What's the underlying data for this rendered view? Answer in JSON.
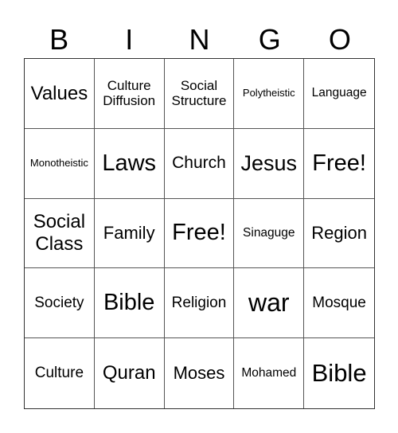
{
  "header": {
    "letters": [
      "B",
      "I",
      "N",
      "G",
      "O"
    ]
  },
  "grid": {
    "rows": [
      [
        "Values",
        "Culture Diffusion",
        "Social Structure",
        "Polytheistic",
        "Language"
      ],
      [
        "Monotheistic",
        "Laws",
        "Church",
        "Jesus",
        "Free!"
      ],
      [
        "Social Class",
        "Family",
        "Free!",
        "Sinaguge",
        "Region"
      ],
      [
        "Society",
        "Bible",
        "Religion",
        "war",
        "Mosque"
      ],
      [
        "Culture",
        "Quran",
        "Moses",
        "Mohamed",
        "Bible"
      ]
    ]
  }
}
